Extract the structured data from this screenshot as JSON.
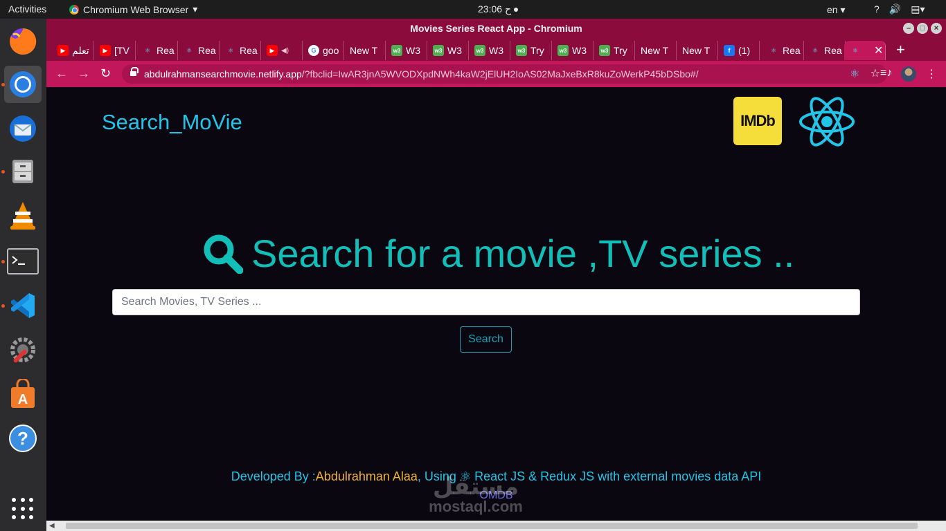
{
  "topbar": {
    "activities": "Activities",
    "app_name": "Chromium Web Browser",
    "time": "23:06 ح",
    "lang": "en"
  },
  "window": {
    "title": "Movies Series React App - Chromium"
  },
  "tabs": [
    {
      "label": "تعلم",
      "icon": "youtube-icon"
    },
    {
      "label": "[TV",
      "icon": "youtube-icon"
    },
    {
      "label": "Rea",
      "icon": "react-icon"
    },
    {
      "label": "Rea",
      "icon": "react-icon"
    },
    {
      "label": "Rea",
      "icon": "react-icon"
    },
    {
      "label": "",
      "icon": "youtube-icon"
    },
    {
      "label": "goo",
      "icon": "google-icon"
    },
    {
      "label": "New T",
      "icon": "none"
    },
    {
      "label": "W3",
      "icon": "w3schools-icon"
    },
    {
      "label": "W3",
      "icon": "w3schools-icon"
    },
    {
      "label": "W3",
      "icon": "w3schools-icon"
    },
    {
      "label": "Try",
      "icon": "w3schools-icon"
    },
    {
      "label": "W3",
      "icon": "w3schools-icon"
    },
    {
      "label": "Try",
      "icon": "w3schools-icon"
    },
    {
      "label": "New T",
      "icon": "none"
    },
    {
      "label": "New T",
      "icon": "none"
    },
    {
      "label": "(1)",
      "icon": "facebook-icon"
    },
    {
      "label": "Rea",
      "icon": "react-icon"
    },
    {
      "label": "Rea",
      "icon": "react-icon"
    },
    {
      "label": "",
      "icon": "react-icon",
      "active": true
    }
  ],
  "omnibox": {
    "host": "abdulrahmansearchmovie.netlify.app",
    "query": "/?fbclid=IwAR3jnA5WVODXpdNWh4kaW2jElUH2IoAS02MaJxeBxR8kuZoWerkP45bDSbo#/"
  },
  "page": {
    "brand": "Search_MoVie",
    "imdb_logo": "IMDb",
    "hero_title": "Search for a movie ,TV series ..",
    "search_placeholder": "Search Movies, TV Series ...",
    "search_button": "Search",
    "footer_prefix": "Developed By :",
    "footer_author": "Abdulrahman Alaa",
    "footer_using": ", Using ",
    "footer_tech": " React JS & Redux JS with external movies data API",
    "footer_api": "OMDB",
    "watermark_ar": "مستقل",
    "watermark_en": "mostaql.com"
  },
  "colors": {
    "accent": "#22c5e8",
    "hero": "#13bdb8",
    "author": "#f2b233",
    "browser_frame": "#8b0b3c",
    "toolbar": "#c2185b"
  }
}
